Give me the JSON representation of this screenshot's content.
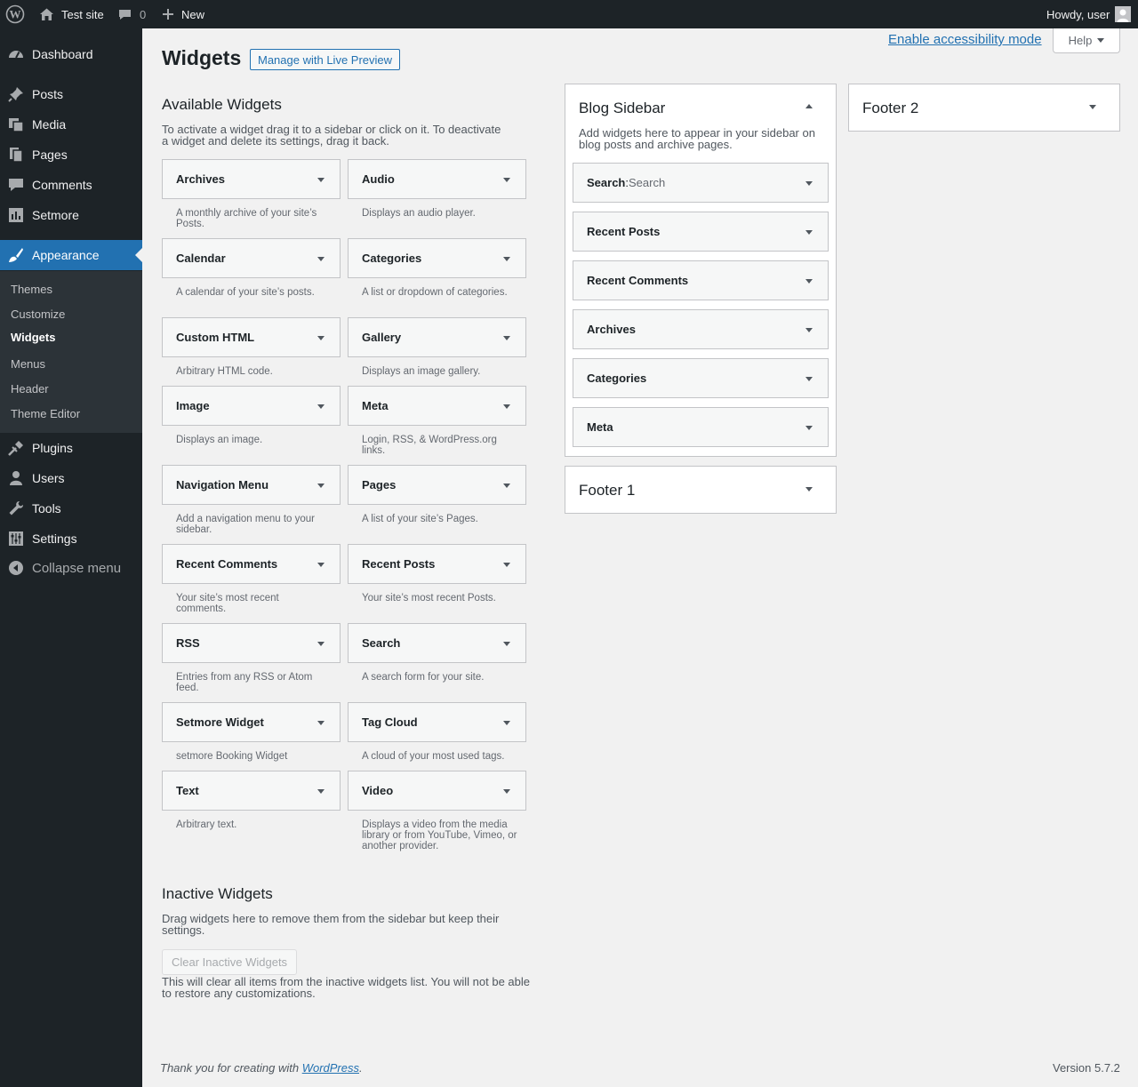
{
  "adminbar": {
    "site_name": "Test site",
    "comments_count": "0",
    "new_label": "New",
    "howdy": "Howdy, user"
  },
  "sidebar": {
    "items": [
      {
        "label": "Dashboard",
        "icon": "dashboard-icon"
      },
      {
        "label": "Posts",
        "icon": "pin-icon"
      },
      {
        "label": "Media",
        "icon": "media-icon"
      },
      {
        "label": "Pages",
        "icon": "pages-icon"
      },
      {
        "label": "Comments",
        "icon": "comment-icon"
      },
      {
        "label": "Setmore",
        "icon": "chart-icon"
      },
      {
        "label": "Appearance",
        "icon": "brush-icon"
      },
      {
        "label": "Plugins",
        "icon": "plug-icon"
      },
      {
        "label": "Users",
        "icon": "user-icon"
      },
      {
        "label": "Tools",
        "icon": "wrench-icon"
      },
      {
        "label": "Settings",
        "icon": "sliders-icon"
      }
    ],
    "submenu": [
      "Themes",
      "Customize",
      "Widgets",
      "Menus",
      "Header",
      "Theme Editor"
    ],
    "collapse_label": "Collapse menu"
  },
  "page": {
    "title": "Widgets",
    "live_preview_label": "Manage with Live Preview",
    "accessibility_link": "Enable accessibility mode",
    "help_label": "Help"
  },
  "available": {
    "title": "Available Widgets",
    "description": "To activate a widget drag it to a sidebar or click on it. To deactivate a widget and delete its settings, drag it back.",
    "widgets": [
      {
        "name": "Archives",
        "desc": "A monthly archive of your site’s Posts."
      },
      {
        "name": "Audio",
        "desc": "Displays an audio player."
      },
      {
        "name": "Calendar",
        "desc": "A calendar of your site’s posts."
      },
      {
        "name": "Categories",
        "desc": "A list or dropdown of categories."
      },
      {
        "name": "Custom HTML",
        "desc": "Arbitrary HTML code."
      },
      {
        "name": "Gallery",
        "desc": "Displays an image gallery."
      },
      {
        "name": "Image",
        "desc": "Displays an image."
      },
      {
        "name": "Meta",
        "desc": "Login, RSS, & WordPress.org links."
      },
      {
        "name": "Navigation Menu",
        "desc": "Add a navigation menu to your sidebar."
      },
      {
        "name": "Pages",
        "desc": "A list of your site’s Pages."
      },
      {
        "name": "Recent Comments",
        "desc": "Your site’s most recent comments."
      },
      {
        "name": "Recent Posts",
        "desc": "Your site’s most recent Posts."
      },
      {
        "name": "RSS",
        "desc": "Entries from any RSS or Atom feed."
      },
      {
        "name": "Search",
        "desc": "A search form for your site."
      },
      {
        "name": "Setmore Widget",
        "desc": "setmore Booking Widget"
      },
      {
        "name": "Tag Cloud",
        "desc": "A cloud of your most used tags."
      },
      {
        "name": "Text",
        "desc": "Arbitrary text."
      },
      {
        "name": "Video",
        "desc": "Displays a video from the media library or from YouTube, Vimeo, or another provider."
      }
    ]
  },
  "blog_sidebar": {
    "title": "Blog Sidebar",
    "description": "Add widgets here to appear in your sidebar on blog posts and archive pages.",
    "widgets": [
      {
        "name": "Search",
        "sep": ": ",
        "title": "Search"
      },
      {
        "name": "Recent Posts",
        "sep": "",
        "title": ""
      },
      {
        "name": "Recent Comments",
        "sep": "",
        "title": ""
      },
      {
        "name": "Archives",
        "sep": "",
        "title": ""
      },
      {
        "name": "Categories",
        "sep": "",
        "title": ""
      },
      {
        "name": "Meta",
        "sep": "",
        "title": ""
      }
    ]
  },
  "footer1": {
    "title": "Footer 1"
  },
  "footer2": {
    "title": "Footer 2"
  },
  "inactive": {
    "title": "Inactive Widgets",
    "description": "Drag widgets here to remove them from the sidebar but keep their settings.",
    "clear_label": "Clear Inactive Widgets",
    "clear_note": "This will clear all items from the inactive widgets list. You will not be able to restore any customizations."
  },
  "footer": {
    "thanks_prefix": "Thank you for creating with ",
    "thanks_link": "WordPress",
    "thanks_suffix": ".",
    "version": "Version 5.7.2"
  }
}
